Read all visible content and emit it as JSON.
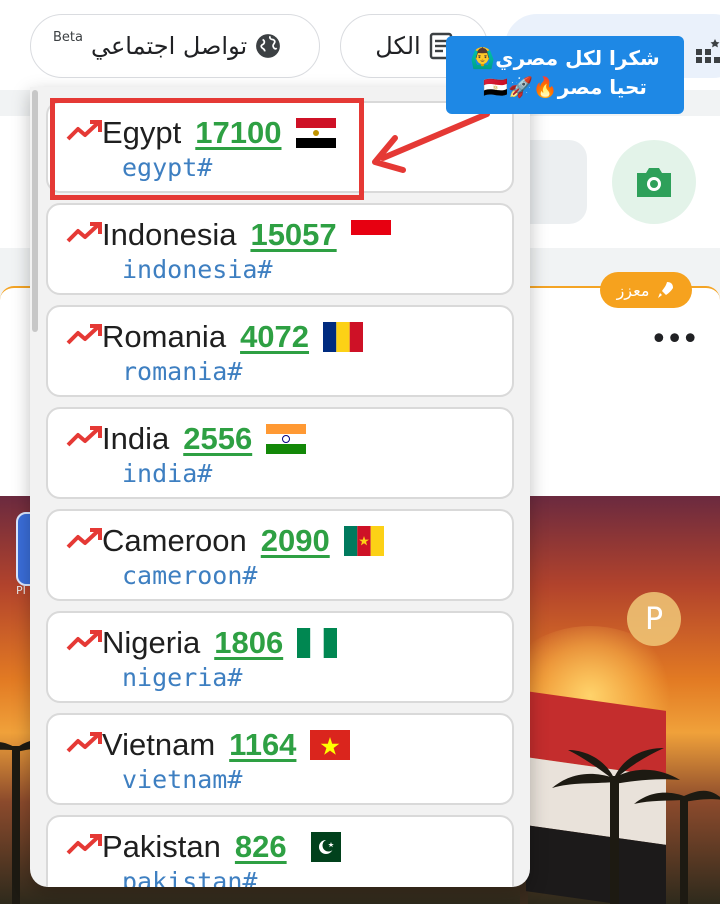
{
  "topbar": {
    "chip_social_label": "تواصل اجتماعي",
    "chip_social_badge": "Beta",
    "chip_all_label": "الكل"
  },
  "background": {
    "boost_badge_label": "معزز",
    "more_label": "•••",
    "coin_label": "P",
    "app_label": "PI"
  },
  "annotation": {
    "line1": "شكرا لكل مصري🙆‍♂️",
    "line2": "تحيا مصر🔥🚀🇪🇬"
  },
  "trending": [
    {
      "country": "Egypt",
      "count": "17100",
      "tag": "egypt#",
      "flag": "egypt"
    },
    {
      "country": "Indonesia",
      "count": "15057",
      "tag": "indonesia#",
      "flag": "indonesia"
    },
    {
      "country": "Romania",
      "count": "4072",
      "tag": "romania#",
      "flag": "romania"
    },
    {
      "country": "India",
      "count": "2556",
      "tag": "india#",
      "flag": "india"
    },
    {
      "country": "Cameroon",
      "count": "2090",
      "tag": "cameroon#",
      "flag": "cameroon"
    },
    {
      "country": "Nigeria",
      "count": "1806",
      "tag": "nigeria#",
      "flag": "nigeria"
    },
    {
      "country": "Vietnam",
      "count": "1164",
      "tag": "vietnam#",
      "flag": "vietnam"
    },
    {
      "country": "Pakistan",
      "count": "826",
      "tag": "pakistan#",
      "flag": "pakistan"
    }
  ],
  "colors": {
    "trend_icon": "#e53935",
    "count": "#2ea043",
    "tag": "#3e7fc1",
    "highlight": "#e53935",
    "callout": "#1e88e5",
    "boost": "#f6a21e"
  }
}
